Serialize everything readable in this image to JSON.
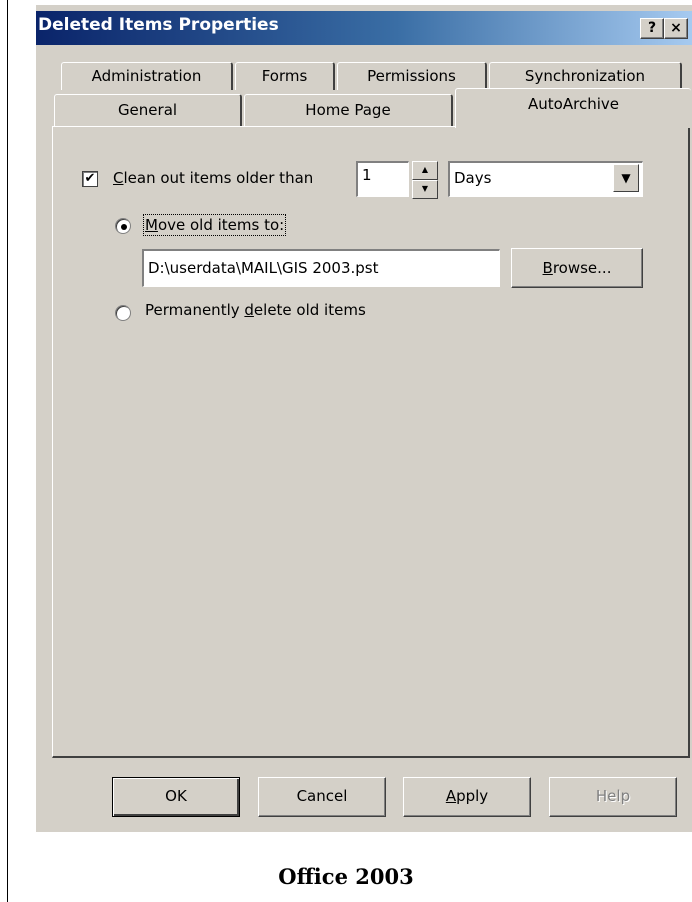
{
  "window": {
    "title": "Deleted Items Properties",
    "help_glyph": "?",
    "close_glyph": "×"
  },
  "tabs": {
    "row1": [
      "Administration",
      "Forms",
      "Permissions",
      "Synchronization"
    ],
    "row2": [
      "General",
      "Home Page",
      "AutoArchive"
    ],
    "active": "AutoArchive"
  },
  "autoarchive": {
    "clean_out_checked": true,
    "clean_out_label_accel": "C",
    "clean_out_label_rest": "lean out items older than",
    "age_value": "1",
    "age_unit": "Days",
    "move_selected": true,
    "move_label_accel": "M",
    "move_label_rest": "ove old items to:",
    "archive_path": "D:\\userdata\\MAIL\\GIS 2003.pst",
    "browse_accel": "B",
    "browse_rest": "rowse...",
    "delete_label_pre": "Permanently ",
    "delete_label_accel": "d",
    "delete_label_rest": "elete old items"
  },
  "buttons": {
    "ok": "OK",
    "cancel": "Cancel",
    "apply_accel": "A",
    "apply_rest": "pply",
    "help": "Help"
  },
  "caption": "Office 2003",
  "colors": {
    "title_start": "#0a246a",
    "title_end": "#a6caf0",
    "face": "#d4d0c8"
  }
}
